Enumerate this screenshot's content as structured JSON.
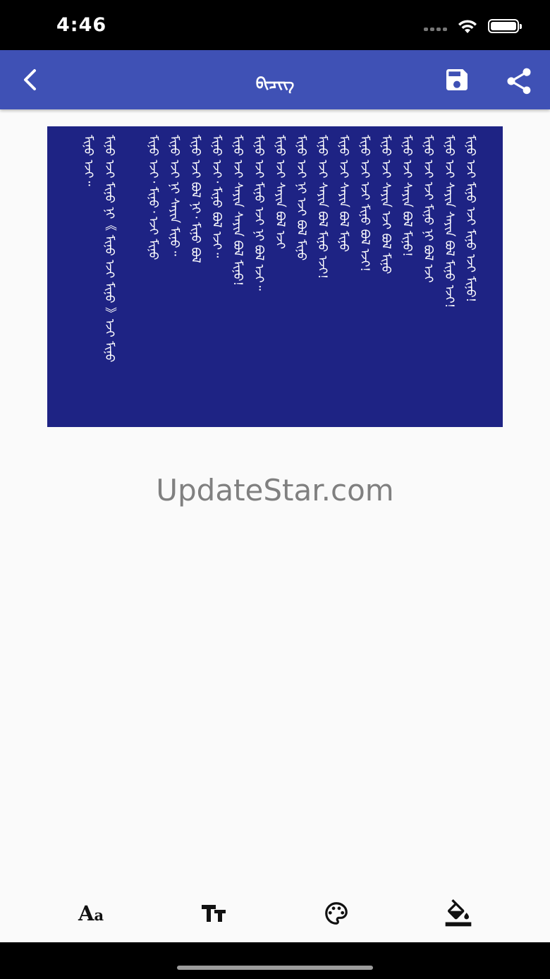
{
  "status_bar": {
    "time": "4:46"
  },
  "app_bar": {
    "title": "ᠪᠢᠴᠢᠭ᠌"
  },
  "preview": {
    "background_color": "#1e2384",
    "text_color": "#ffffff",
    "lines": [
      "ᠮᠢᠨᠤ ᠡᠵᠢ ᠮᠢᠨᠤ ᠡᠵᠢ ᠮᠢᠨᠤ ᠡᠵᠢ ᠮᠢᠨᠤ!",
      "ᠮᠢᠨᠤ ᠡᠵᠢ ᠰᠠᠶᠢᠨ ᠰᠠᠶᠢᠨ ᠪᠣᠯ ᠮᠢᠨᠤ ᠡᠵᠢ!",
      "ᠮᠢᠨᠤ ᠡᠵᠢ ᠡᠵᠢ ᠮᠢᠨᠤ ᠨᠢ ᠪᠣᠯ ᠡᠵᠢ",
      "ᠮᠢᠨᠤ ᠡᠵᠢ ᠰᠠᠶᠢᠨ ᠪᠣᠯ ᠮᠢᠨᠤ!",
      "ᠮᠢᠨᠤ ᠡᠵᠢ ᠰᠠᠶᠢᠨ ᠡᠵᠢ ᠪᠣᠯ ᠮᠢᠨᠤ",
      "ᠮᠢᠨᠤ ᠡᠵᠢ ᠡᠵᠢ ᠮᠢᠨᠤ ᠪᠣᠯ ᠡᠵᠢ!",
      "ᠮᠢᠨᠤ ᠡᠵᠢ ᠰᠠᠶᠢᠨ ᠪᠣᠯ ᠮᠢᠨᠤ",
      "ᠮᠢᠨᠤ ᠡᠵᠢ ᠰᠠᠶᠢᠨ ᠪᠣᠯ ᠮᠢᠨᠤ ᠡᠵᠢ!",
      "ᠮᠢᠨᠤ ᠡᠵᠢ ᠨᠢ ᠡᠵᠢ ᠪᠣᠯ ᠮᠢᠨᠤ",
      "ᠮᠢᠨᠤ ᠡᠵᠢ ᠰᠠᠶᠢᠨ ᠪᠣᠯ ᠡᠵᠢ",
      "ᠮᠢᠨᠤ ᠡᠵᠢ ᠮᠢᠨᠤ ᠡᠵᠢ ᠨᠢ ᠪᠣᠯ ᠡᠵᠢ᠃",
      "ᠮᠢᠨᠤ ᠡᠵᠢ ᠰᠠᠶᠢᠨ ᠰᠠᠶᠢᠨ ᠪᠣᠯ ᠮᠢᠨᠤ!",
      "ᠮᠢᠨᠤ ᠡᠵᠢ᠂ ᠮᠢᠨᠤ ᠪᠣᠯ ᠡᠵᠢ᠃",
      "ᠮᠢᠨᠤ ᠡᠵᠢ ᠪᠣᠯ ᠨᠢ᠂ ᠮᠢᠨᠤ ᠪᠣᠯ",
      "ᠮᠢᠨᠤ ᠡᠵᠢ ᠨᠢ ᠰᠠᠶᠢᠨ ᠮᠢᠨᠤ᠃",
      "ᠮᠢᠨᠤ ᠡᠵᠢ᠂ ᠮᠢᠨᠤ᠂ ᠡᠵᠢ ᠮᠢᠨᠤ",
      "ᠮᠢᠨᠤ ᠡᠵᠢ ᠮᠢᠨᠤ ᠨᠢ《 ᠮᠢᠨᠤ ᠡᠵᠢ ᠮᠢᠨᠤ 》ᠡᠵᠢ ᠮᠢᠨᠤ",
      "ᠮᠢᠨᠤ ᠡᠵᠢ᠃"
    ]
  },
  "watermark": "UpdateStar.com",
  "toolbar": {
    "font_label": "A",
    "font_label_small": "a",
    "icons": [
      "font-icon",
      "text-size-icon",
      "palette-icon",
      "fill-color-icon"
    ]
  },
  "colors": {
    "app_bar": "#3f51b5",
    "preview_bg": "#1e2384",
    "background": "#fafafa"
  }
}
